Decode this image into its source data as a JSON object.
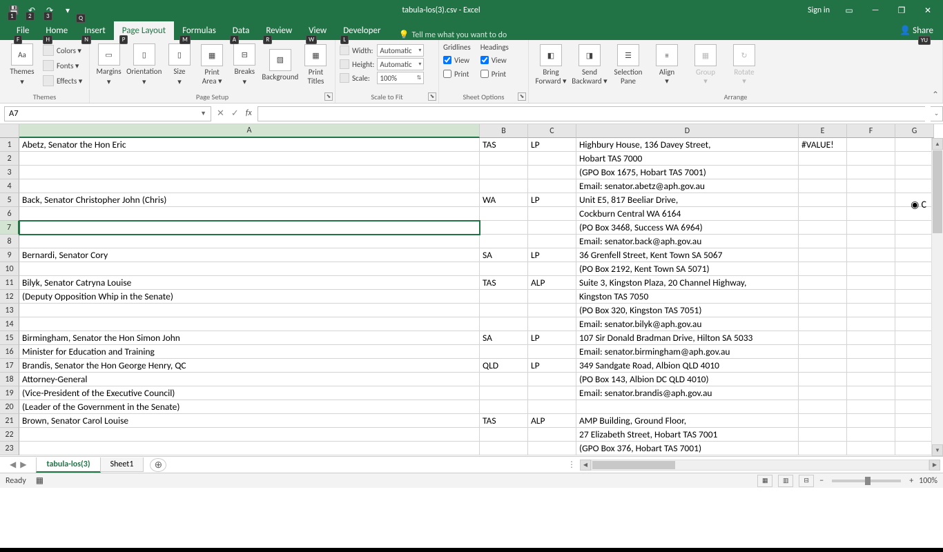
{
  "title": "tabula-los(3).csv - Excel",
  "title_right": {
    "signin": "Sign in"
  },
  "tabs": {
    "file": "File",
    "home": "Home",
    "insert": "Insert",
    "page_layout": "Page Layout",
    "formulas": "Formulas",
    "data": "Data",
    "review": "Review",
    "view": "View",
    "developer": "Developer",
    "tell_me": "Tell me what you want to do"
  },
  "keytips": {
    "qat1": "1",
    "qat2": "2",
    "qat3": "3",
    "file": "F",
    "home": "H",
    "insert": "N",
    "page": "P",
    "formulas": "M",
    "data": "A",
    "review": "R",
    "view": "W",
    "developer": "L",
    "tell": "Q",
    "share": "YU"
  },
  "ribbon": {
    "themes": {
      "title": "Themes",
      "big": "Themes",
      "colors": "Colors ▾",
      "fonts": "Fonts ▾",
      "effects": "Effects ▾"
    },
    "page_setup": {
      "title": "Page Setup",
      "margins": "Margins",
      "orientation": "Orientation",
      "size": "Size",
      "print_area": "Print\nArea ▾",
      "breaks": "Breaks",
      "background": "Background",
      "print_titles": "Print\nTitles"
    },
    "scale": {
      "title": "Scale to Fit",
      "width_l": "Width:",
      "height_l": "Height:",
      "scale_l": "Scale:",
      "width_v": "Automatic",
      "height_v": "Automatic",
      "scale_v": "100%"
    },
    "sheet": {
      "title": "Sheet Options",
      "gridlines": "Gridlines",
      "headings": "Headings",
      "view": "View",
      "print": "Print"
    },
    "arrange": {
      "title": "Arrange",
      "bring": "Bring\nForward ▾",
      "send": "Send\nBackward ▾",
      "selpane": "Selection\nPane",
      "align": "Align\n▾",
      "group": "Group\n▾",
      "rotate": "Rotate\n▾"
    }
  },
  "name_box": "A7",
  "columns": [
    "A",
    "B",
    "C",
    "D",
    "E",
    "F",
    "G"
  ],
  "rows": [
    {
      "n": 1,
      "A": "Abetz, Senator the Hon Eric",
      "B": "TAS",
      "C": "LP",
      "D": "Highbury House, 136 Davey Street,",
      "E": "#VALUE!"
    },
    {
      "n": 2,
      "D": "Hobart TAS  7000"
    },
    {
      "n": 3,
      "D": "(GPO Box 1675, Hobart TAS 7001)"
    },
    {
      "n": 4,
      "D": "Email: senator.abetz@aph.gov.au"
    },
    {
      "n": 5,
      "A": "Back, Senator Christopher John (Chris)",
      "B": "WA",
      "C": "LP",
      "D": "Unit E5, 817 Beeliar Drive,"
    },
    {
      "n": 6,
      "D": "Cockburn Central WA 6164"
    },
    {
      "n": 7,
      "D": "(PO Box 3468, Success WA 6964)"
    },
    {
      "n": 8,
      "D": "Email: senator.back@aph.gov.au"
    },
    {
      "n": 9,
      "A": "Bernardi, Senator Cory",
      "B": "SA",
      "C": "LP",
      "D": "36 Grenfell Street, Kent Town SA 5067"
    },
    {
      "n": 10,
      "D": "(PO Box 2192, Kent Town SA 5071)"
    },
    {
      "n": 11,
      "A": "Bilyk, Senator Catryna Louise",
      "B": "TAS",
      "C": "ALP",
      "D": "Suite 3, Kingston Plaza, 20 Channel Highway,"
    },
    {
      "n": 12,
      "A": "(Deputy Opposition Whip in the Senate)",
      "D": "Kingston TAS 7050"
    },
    {
      "n": 13,
      "D": "(PO Box 320, Kingston TAS 7051)"
    },
    {
      "n": 14,
      "D": "Email: senator.bilyk@aph.gov.au"
    },
    {
      "n": 15,
      "A": "Birmingham, Senator the Hon Simon John",
      "B": "SA",
      "C": "LP",
      "D": "107 Sir Donald Bradman Drive, Hilton SA 5033"
    },
    {
      "n": 16,
      "A": "Minister for Education and Training",
      "D": "Email: senator.birmingham@aph.gov.au"
    },
    {
      "n": 17,
      "A": "Brandis, Senator the Hon George Henry, QC",
      "B": "QLD",
      "C": "LP",
      "D": "349 Sandgate Road, Albion QLD 4010"
    },
    {
      "n": 18,
      "A": "Attorney-General",
      "D": "(PO Box 143, Albion DC QLD 4010)"
    },
    {
      "n": 19,
      "A": "(Vice-President of the Executive Council)",
      "D": "Email: senator.brandis@aph.gov.au"
    },
    {
      "n": 20,
      "A": "(Leader of the Government in the Senate)"
    },
    {
      "n": 21,
      "A": "Brown, Senator Carol Louise",
      "B": "TAS",
      "C": "ALP",
      "D": "AMP Building, Ground Floor,"
    },
    {
      "n": 22,
      "D": "27 Elizabeth Street, Hobart TAS 7001"
    },
    {
      "n": 23,
      "D": "(GPO Box 376, Hobart TAS 7001)"
    }
  ],
  "sheets": {
    "active": "tabula-los(3)",
    "other": "Sheet1"
  },
  "status": {
    "ready": "Ready",
    "zoom": "100%"
  }
}
